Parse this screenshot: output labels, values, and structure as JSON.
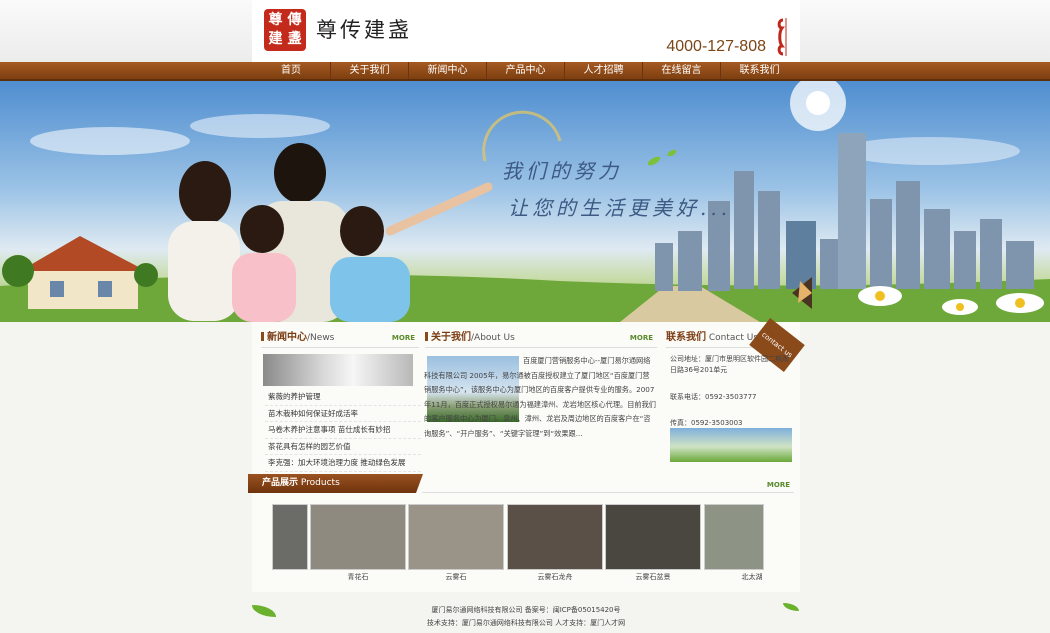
{
  "header": {
    "logo_seal": [
      "尊",
      "傳",
      "建",
      "盞"
    ],
    "logo_text": "尊传建盏",
    "phone": "4000-127-808"
  },
  "nav": [
    "首页",
    "关于我们",
    "新闻中心",
    "产品中心",
    "人才招聘",
    "在线留言",
    "联系我们"
  ],
  "banner": {
    "slogan_line1": "我们的努力",
    "slogan_line2": "让您的生活更美好..."
  },
  "news": {
    "title_zh": "新闻中心",
    "title_en": "News",
    "more": "MORE",
    "items": [
      "紫薇的养护管理",
      "苗木栽种如何保证好成活率",
      "马卷木养护注意事项 苗仕成长有妙招",
      "茶花具有怎样的园艺价值",
      "李克强：加大环境治理力度 推动绿色发展"
    ]
  },
  "about": {
    "title_zh": "关于我们",
    "title_en": "About Us",
    "more": "MORE",
    "text": "百度厦门营销服务中心--厦门易尔通网络科技有限公司 2005年，易尔通被百度授权建立了厦门地区“百度厦门营销服务中心”，该服务中心为厦门地区的百度客户提供专业的服务。2007年11月，百度正式授权易尔通为福建漳州、龙岩地区核心代理。目前我们的客户服务中心为厦门、泉州、漳州、龙岩及周边地区的百度客户在“咨询服务”、“开户服务”、“关键字管理”到“效果跟..."
  },
  "contact": {
    "title_zh": "联系我们",
    "title_en": "Contact Us",
    "badge": "contact us",
    "address": "公司地址：厦门市思明区软件园二期观日路36号201单元",
    "phone": "联系电话：0592-3503777",
    "fax": "传真：0592-3503003"
  },
  "products": {
    "title_zh": "产品展示",
    "title_en": "Products",
    "more": "MORE",
    "items": [
      {
        "caption": ""
      },
      {
        "caption": "青花石"
      },
      {
        "caption": "云雾石"
      },
      {
        "caption": "云雾石龙舟"
      },
      {
        "caption": "云雾石盆景"
      },
      {
        "caption": "北太湖"
      }
    ]
  },
  "footer": {
    "line1": "厦门易尔通网络科技有限公司 备案号：闽ICP备05015420号",
    "line2": "技术支持：厦门易尔通网络科技有限公司 人才支持：厦门人才网"
  },
  "colors": {
    "nav_brown": "#8a4a1a",
    "accent_brown": "#7a3b12",
    "phone_brown": "#7a4616",
    "seal_red": "#c42a1c",
    "leaf_green": "#6ab12d"
  }
}
